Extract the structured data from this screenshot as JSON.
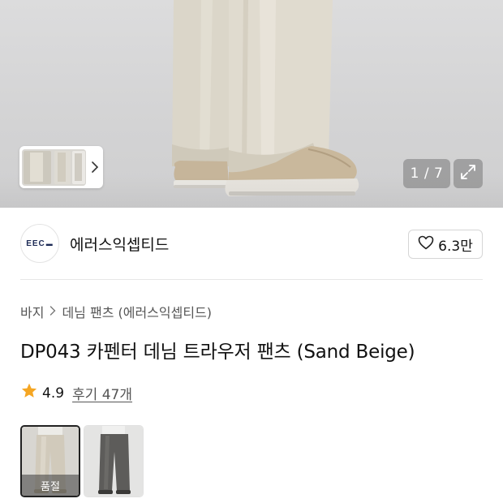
{
  "gallery": {
    "counter": "1 / 7",
    "thumb_strip_icon": "chevron-right-icon",
    "expand_icon": "expand-icon"
  },
  "brand": {
    "logo_text": "EEC",
    "name": "에러스익셉티드",
    "like_icon": "heart-outline-icon",
    "like_count": "6.3만"
  },
  "breadcrumb": {
    "items": [
      "바지",
      "데님 팬츠 (에러스익셉티드)"
    ],
    "separator_icon": "chevron-right-icon"
  },
  "product": {
    "title": "DP043 카펜터 데님 트라우저 팬츠 (Sand Beige)"
  },
  "rating": {
    "icon": "star-icon",
    "score": "4.9",
    "reviews": "후기 47개"
  },
  "options": {
    "items": [
      {
        "color": "Sand Beige",
        "status": "품절",
        "selected": true
      },
      {
        "color": "Charcoal",
        "status": "",
        "selected": false
      }
    ]
  },
  "colors": {
    "star": "#f5a623",
    "pants_beige": "#d9d4c6",
    "shoe_suede": "#c8b79c",
    "charcoal": "#5a5a5a"
  }
}
